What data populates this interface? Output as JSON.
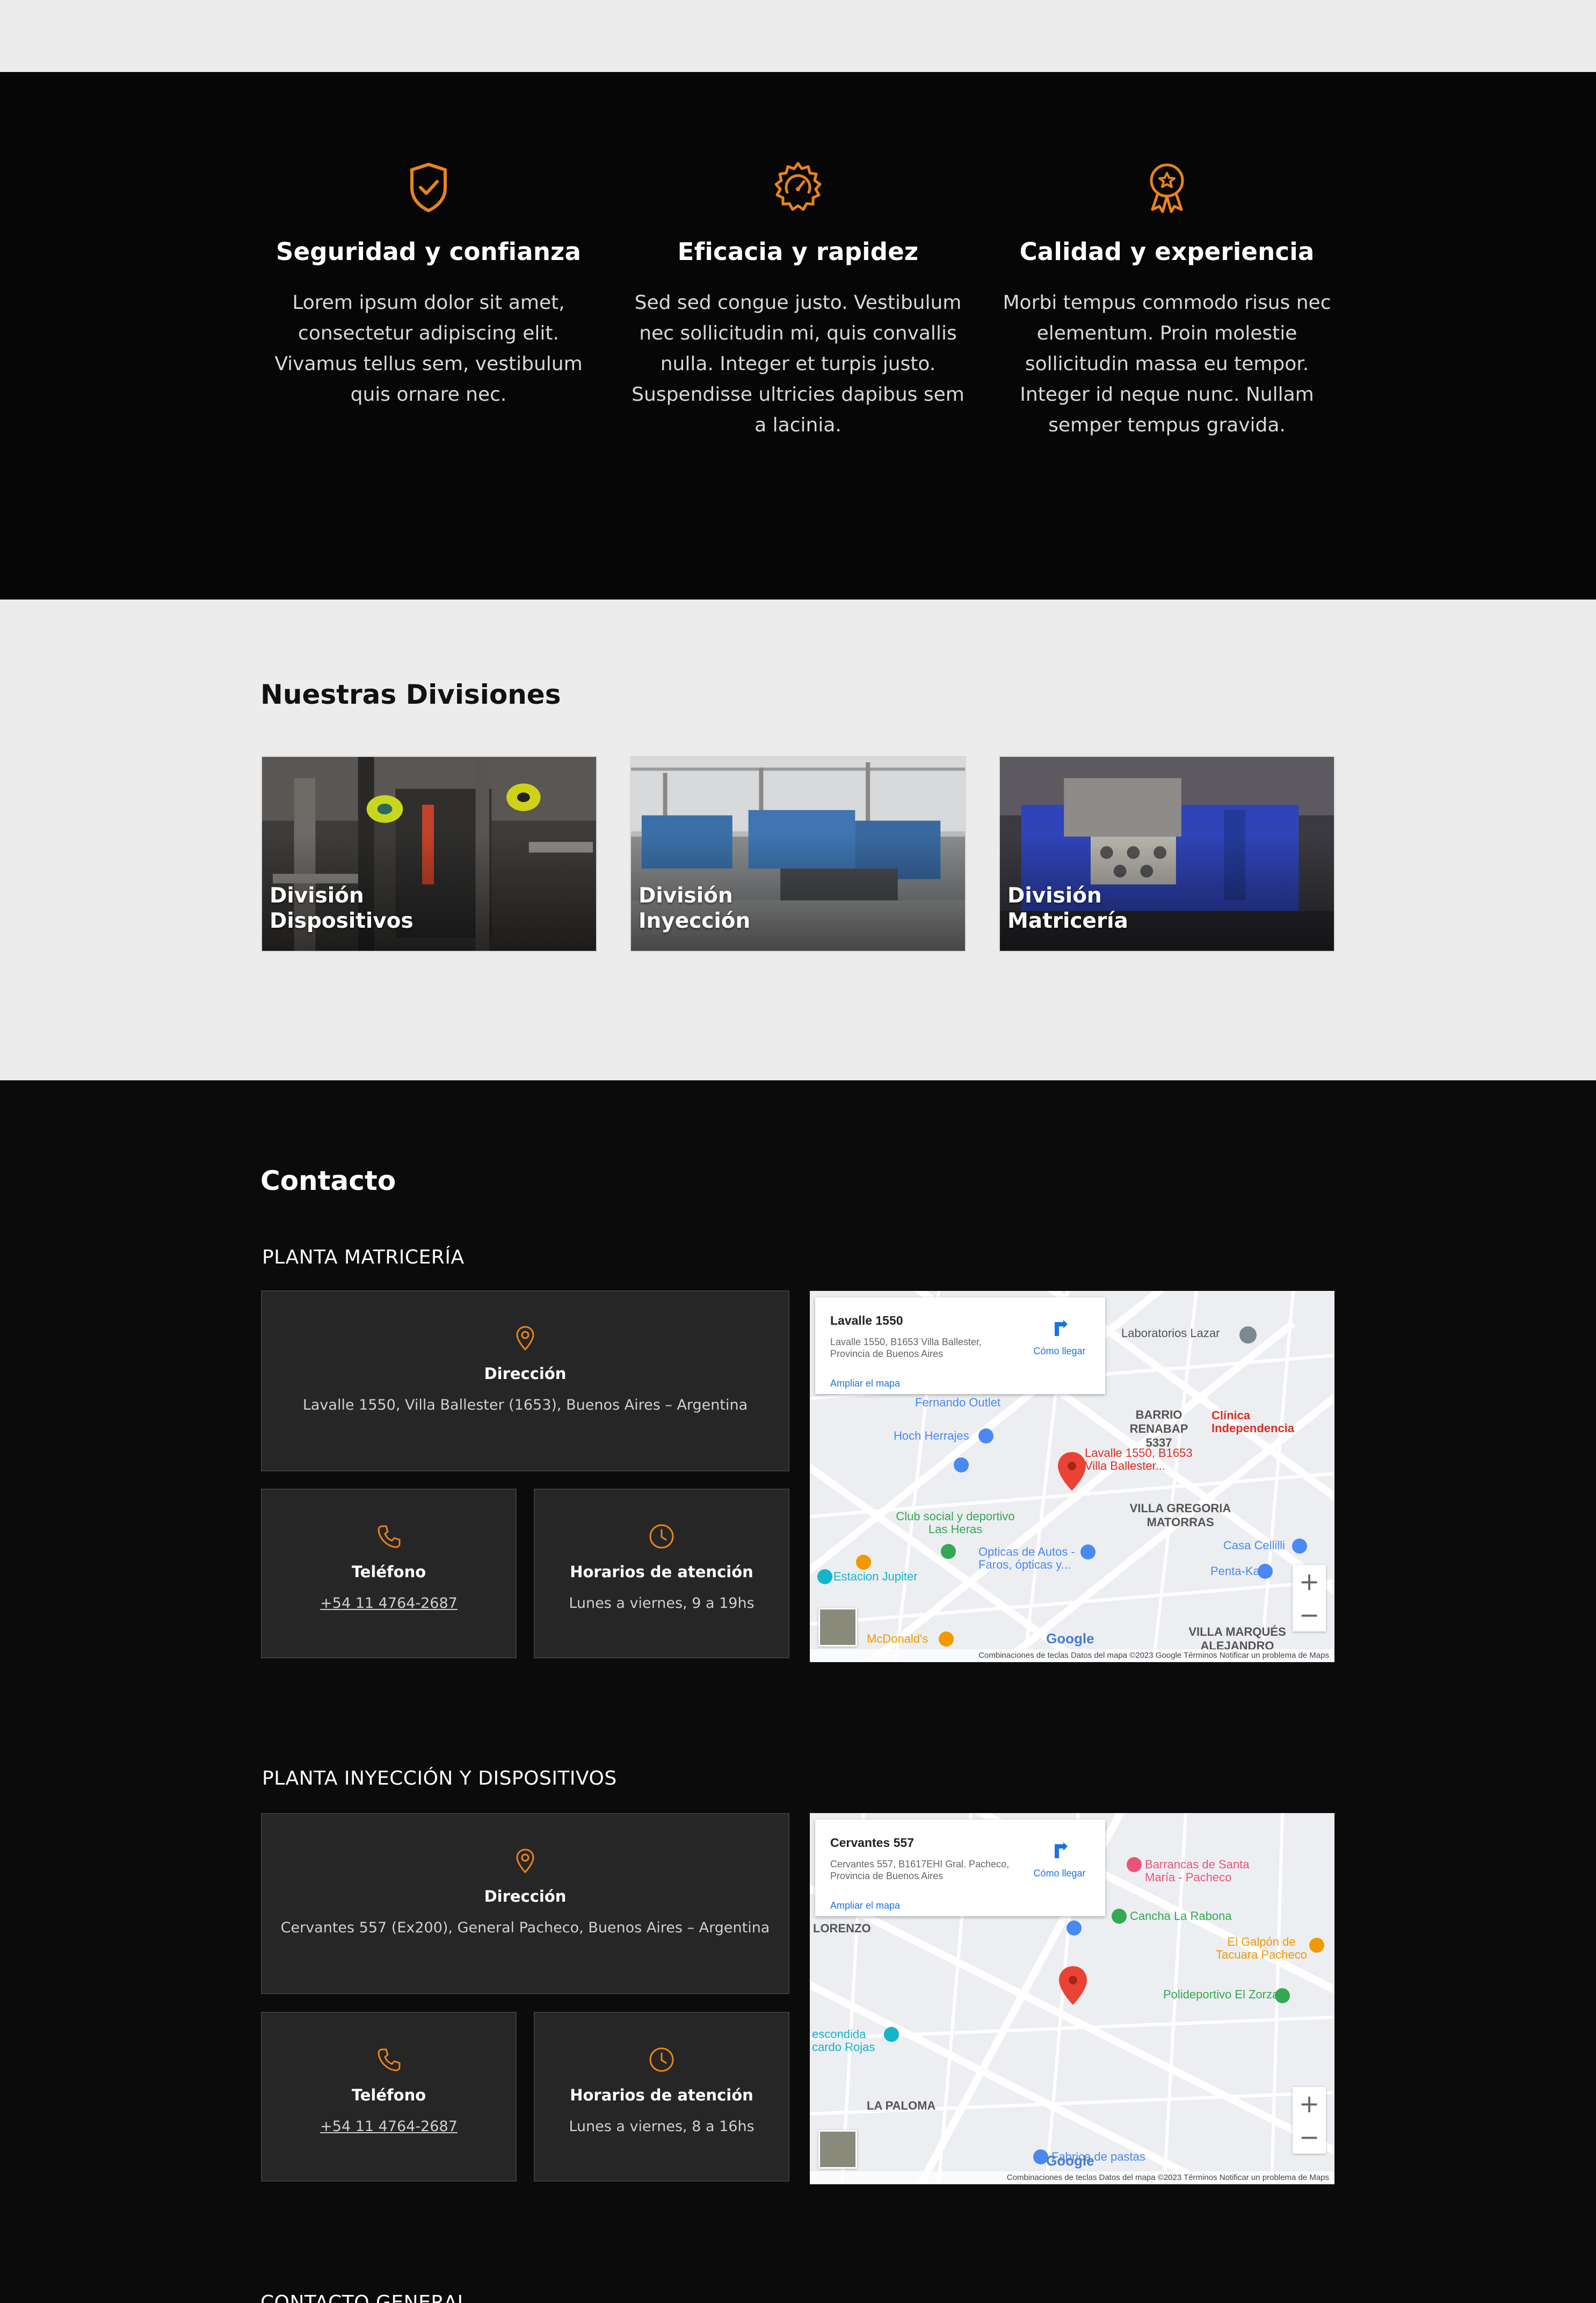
{
  "features": [
    {
      "icon": "shield-check-icon",
      "title": "Seguridad y confianza",
      "text": "Lorem ipsum dolor sit amet, consectetur adipiscing elit. Vivamus tellus sem, vestibulum quis ornare nec."
    },
    {
      "icon": "gear-speed-icon",
      "title": "Eficacia y rapidez",
      "text": "Sed sed congue justo. Vestibulum nec sollicitudin mi, quis convallis nulla. Integer et turpis justo. Suspendisse ultricies dapibus sem a lacinia."
    },
    {
      "icon": "award-star-icon",
      "title": "Calidad y experiencia",
      "text": "Morbi tempus commodo risus nec elementum. Proin molestie sollicitudin massa eu tempor. Integer id neque nunc. Nullam semper tempus gravida."
    }
  ],
  "divisions": {
    "title": "Nuestras Divisiones",
    "cards": [
      {
        "line1": "División",
        "line2": "Dispositivos"
      },
      {
        "line1": "División",
        "line2": "Inyección"
      },
      {
        "line1": "División",
        "line2": "Matricería"
      }
    ]
  },
  "contact": {
    "title": "Contacto",
    "plants": [
      {
        "title": "PLANTA MATRICERÍA",
        "address_label": "Dirección",
        "address": "Lavalle 1550, Villa Ballester (1653), Buenos Aires – Argentina",
        "phone_label": "Teléfono",
        "phone": "+54 11 4764-2687",
        "hours_label": "Horarios de atención",
        "hours": "Lunes a viernes, 9 a 19hs",
        "map": {
          "place": "Lavalle 1550",
          "place_address": "Lavalle 1550, B1653 Villa Ballester, Provincia de Buenos Aires",
          "directions": "Cómo llegar",
          "expand": "Ampliar el mapa",
          "attribution": "Combinaciones de teclas   Datos del mapa ©2023 Google   Términos   Notificar un problema de Maps",
          "labels": [
            "Laboratorios Lazar",
            "Clínica Independencia",
            "BARRIO RENABAP 5337",
            "Fernando Outlet",
            "Hoch Herrajes",
            "Lavalle 1550, B1653 Villa Ballester...",
            "Club social y deportivo Las Heras",
            "Opticas de Autos - Faros, ópticas y...",
            "Casa Cellilli",
            "Penta-Ka",
            "VILLA GREGORIA MATORRAS",
            "Estacion Jupiter",
            "VILLA MARQUÉS ALEJANDRO",
            "McDonald's"
          ]
        }
      },
      {
        "title": "PLANTA INYECCIÓN Y DISPOSITIVOS",
        "address_label": "Dirección",
        "address": "Cervantes 557 (Ex200), General Pacheco, Buenos Aires – Argentina",
        "phone_label": "Teléfono",
        "phone": "+54 11 4764-2687",
        "hours_label": "Horarios de atención",
        "hours": "Lunes a viernes, 8 a 16hs",
        "map": {
          "place": "Cervantes 557",
          "place_address": "Cervantes 557, B1617EHI Gral. Pacheco, Provincia de Buenos Aires",
          "directions": "Cómo llegar",
          "expand": "Ampliar el mapa",
          "attribution": "Combinaciones de teclas   Datos del mapa ©2023   Términos   Notificar un problema de Maps",
          "labels": [
            "Barrancas de Santa María - Pacheco",
            "Cancha La Rabona",
            "El Galpón de Tacuara Pacheco",
            "Polideportivo El Zorzal",
            "LORENZO",
            "escondida cardo Rojas",
            "LA PALOMA",
            "Fabrica de pastas"
          ]
        }
      }
    ],
    "general_title": "CONTACTO GENERAL"
  },
  "colors": {
    "accent": "#e8841a",
    "dark": "#060606",
    "light": "#ececec",
    "box": "#262626"
  }
}
